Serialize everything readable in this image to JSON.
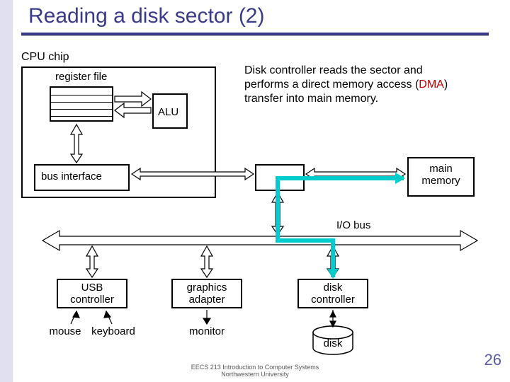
{
  "slide": {
    "title": "Reading a disk sector (2)",
    "cpu_chip": "CPU chip",
    "register_file": "register file",
    "alu": "ALU",
    "bus_interface": "bus interface",
    "main_memory": "main\nmemory",
    "io_bus": "I/O bus",
    "usb_controller": "USB\ncontroller",
    "graphics_adapter": "graphics\nadapter",
    "disk_controller": "disk\ncontroller",
    "mouse": "mouse",
    "keyboard": "keyboard",
    "monitor": "monitor",
    "disk": "disk",
    "description_line1": "Disk controller reads the sector and",
    "description_line2": "performs a direct memory access (",
    "description_dma": "DMA",
    "description_line3": ")",
    "description_line4": "transfer into main memory.",
    "footer1": "EECS 213 Introduction to Computer Systems",
    "footer2": "Northwestern University",
    "slide_number": "26"
  }
}
